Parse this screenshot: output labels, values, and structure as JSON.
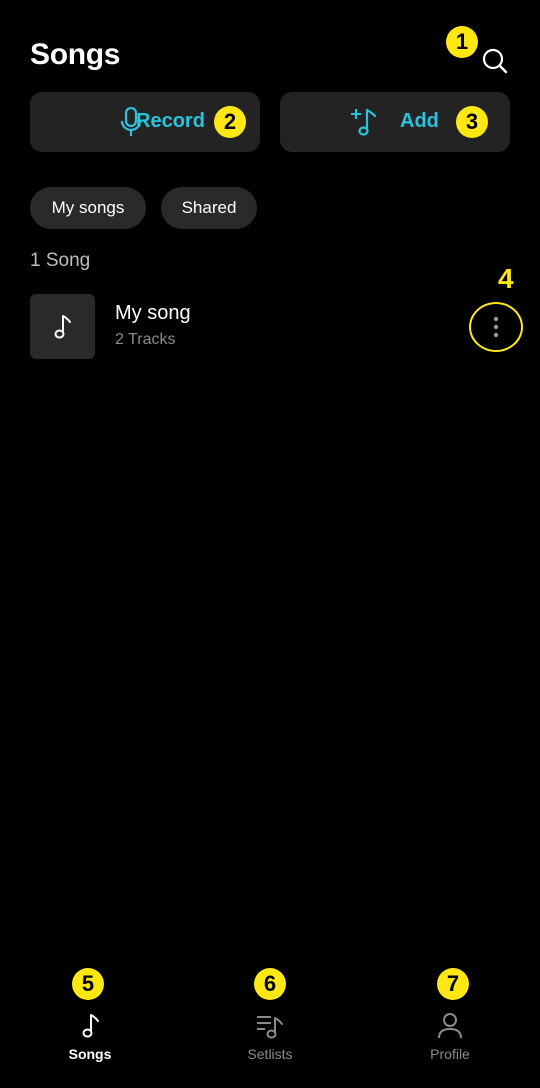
{
  "header": {
    "title": "Songs"
  },
  "actions": {
    "record_label": "Record",
    "add_label": "Add"
  },
  "filters": {
    "my_songs": "My songs",
    "shared": "Shared"
  },
  "songs": {
    "count_label": "1 Song",
    "items": [
      {
        "name": "My song",
        "subtitle": "2 Tracks"
      }
    ]
  },
  "nav": {
    "songs": "Songs",
    "setlists": "Setlists",
    "profile": "Profile"
  },
  "annotations": {
    "n1": "1",
    "n2": "2",
    "n3": "3",
    "n4": "4",
    "n5": "5",
    "n6": "6",
    "n7": "7"
  },
  "colors": {
    "background": "#000000",
    "accent": "#29c3de",
    "card": "#232323",
    "chip": "#2a2a2a",
    "annotation": "#ffe812",
    "muted": "#8a8a8a"
  },
  "icons": [
    "search-icon",
    "microphone-icon",
    "add-music-icon",
    "music-note-icon",
    "more-vertical-icon",
    "setlist-icon",
    "profile-icon"
  ]
}
